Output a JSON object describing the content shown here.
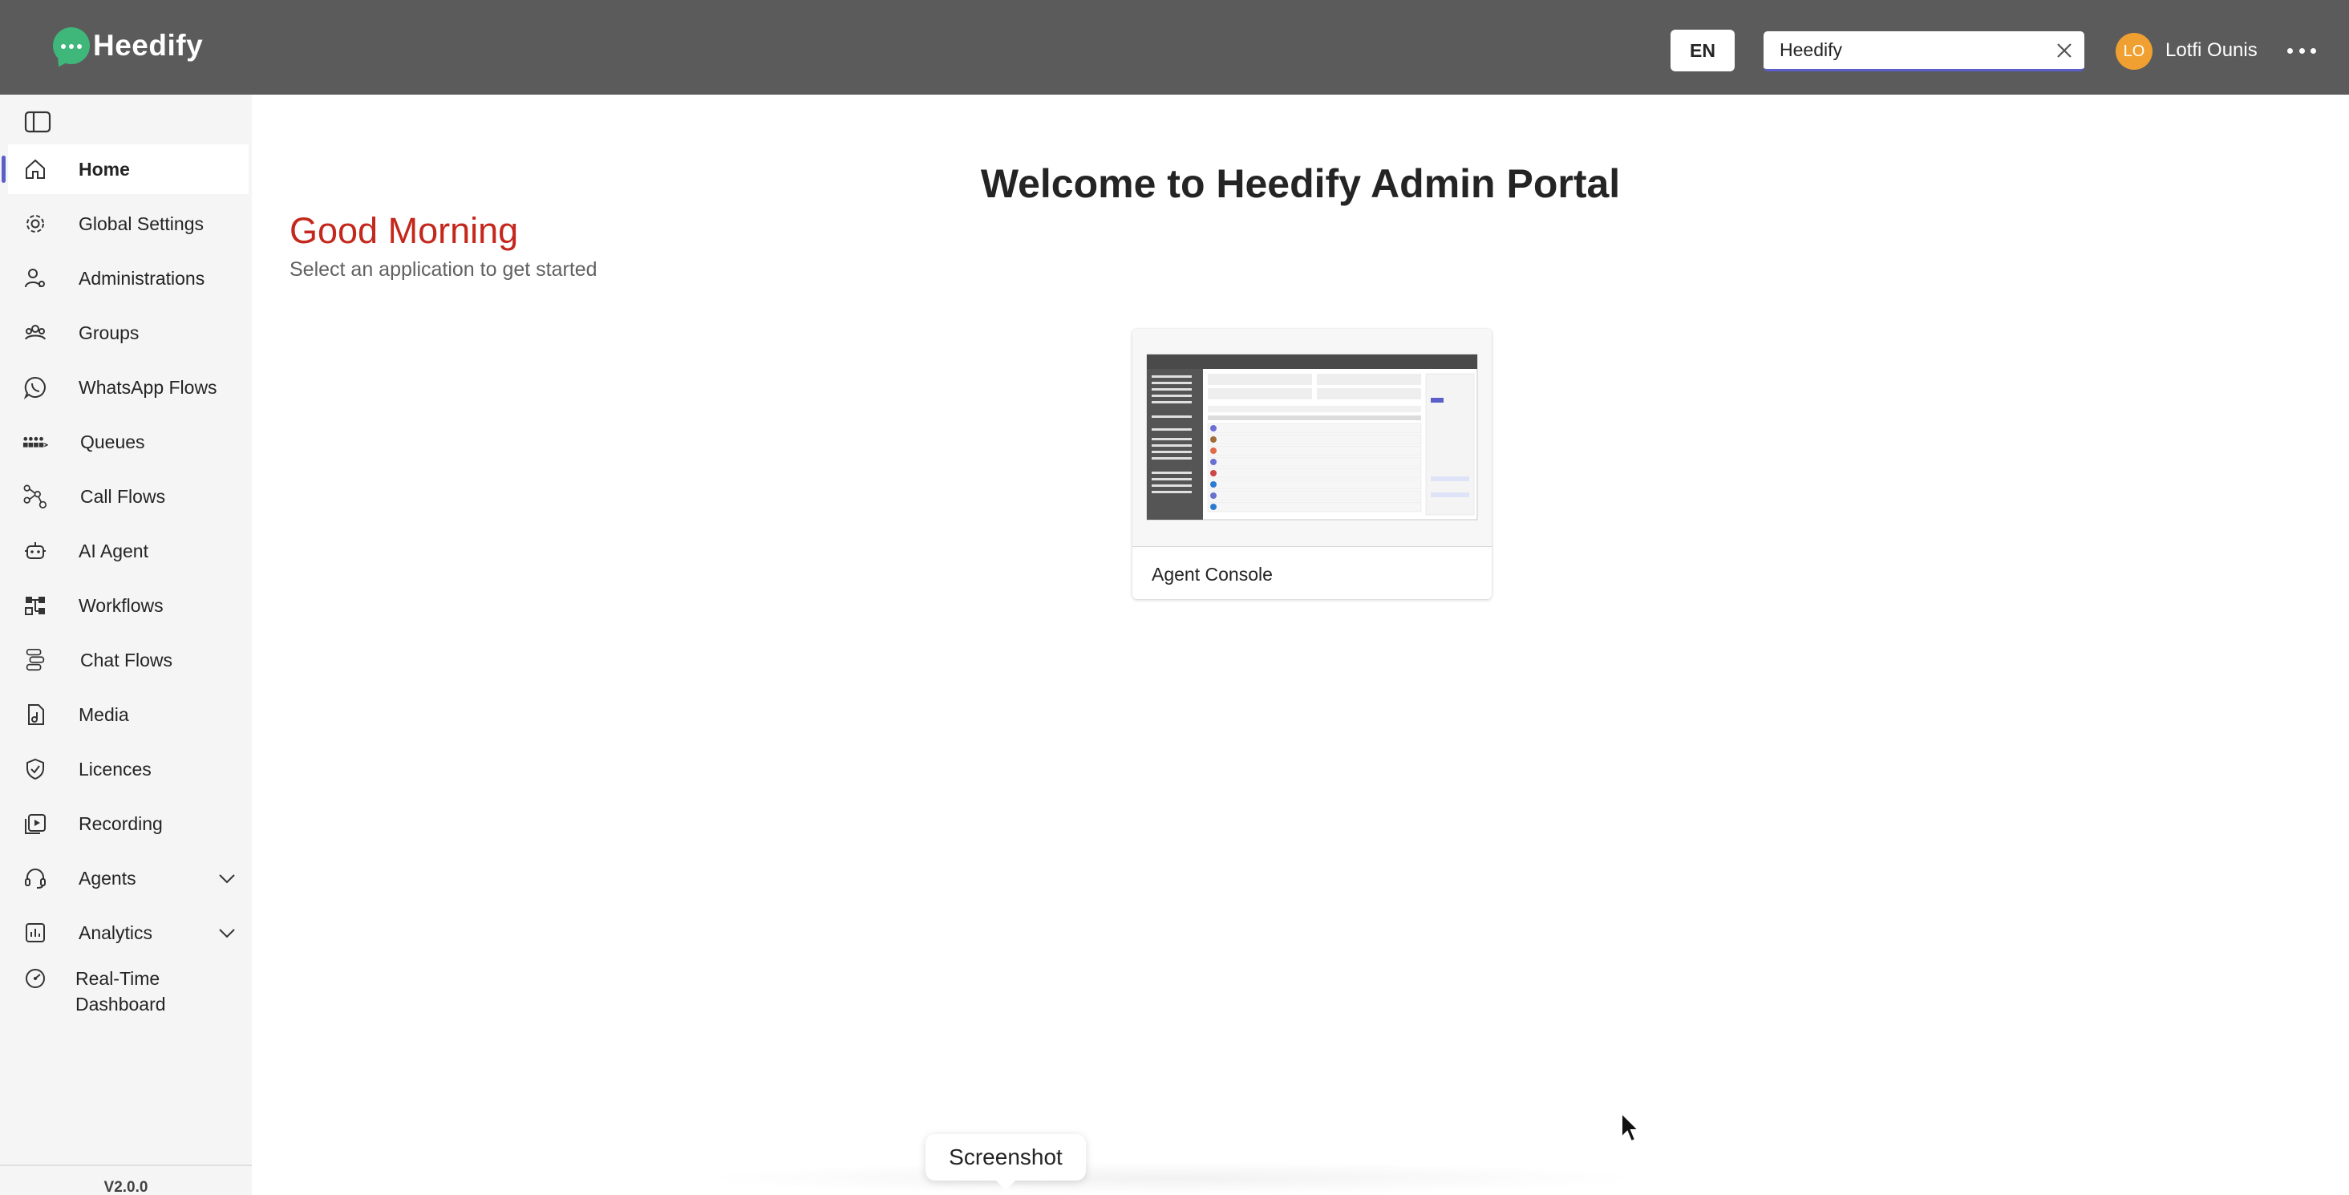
{
  "header": {
    "brand": "Heedify",
    "language": "EN",
    "search": {
      "value": "Heedify",
      "placeholder": ""
    },
    "user": {
      "initials": "LO",
      "name": "Lotfi Ounis"
    },
    "colors": {
      "bar": "#5b5b5b",
      "accent": "#5b5fc7",
      "logo": "#3fb67a",
      "avatar": "#f0a030"
    }
  },
  "sidebar": {
    "toggle_icon": "sidebar-toggle-icon",
    "items": [
      {
        "label": "Home",
        "icon": "home-icon",
        "active": true
      },
      {
        "label": "Global Settings",
        "icon": "gear-icon"
      },
      {
        "label": "Administrations",
        "icon": "admin-user-icon"
      },
      {
        "label": "Groups",
        "icon": "group-icon"
      },
      {
        "label": "WhatsApp Flows",
        "icon": "whatsapp-icon"
      },
      {
        "label": "Queues",
        "icon": "queue-icon"
      },
      {
        "label": "Call Flows",
        "icon": "flow-icon"
      },
      {
        "label": "AI Agent",
        "icon": "bot-icon"
      },
      {
        "label": "Workflows",
        "icon": "workflow-icon"
      },
      {
        "label": "Chat Flows",
        "icon": "chat-flow-icon"
      },
      {
        "label": "Media",
        "icon": "media-file-icon"
      },
      {
        "label": "Licences",
        "icon": "shield-check-icon"
      },
      {
        "label": "Recording",
        "icon": "recording-icon"
      },
      {
        "label": "Agents",
        "icon": "headset-icon",
        "expandable": true
      },
      {
        "label": "Analytics",
        "icon": "analytics-icon",
        "expandable": true
      },
      {
        "label": "Real-Time\nDashboard",
        "icon": "gauge-icon"
      }
    ],
    "version": "V2.0.0"
  },
  "main": {
    "title": "Welcome to Heedify Admin Portal",
    "greeting": "Good Morning",
    "subtitle": "Select an application to get started",
    "apps": [
      {
        "label": "Agent Console"
      }
    ]
  },
  "overlay": {
    "tooltip": "Screenshot"
  }
}
